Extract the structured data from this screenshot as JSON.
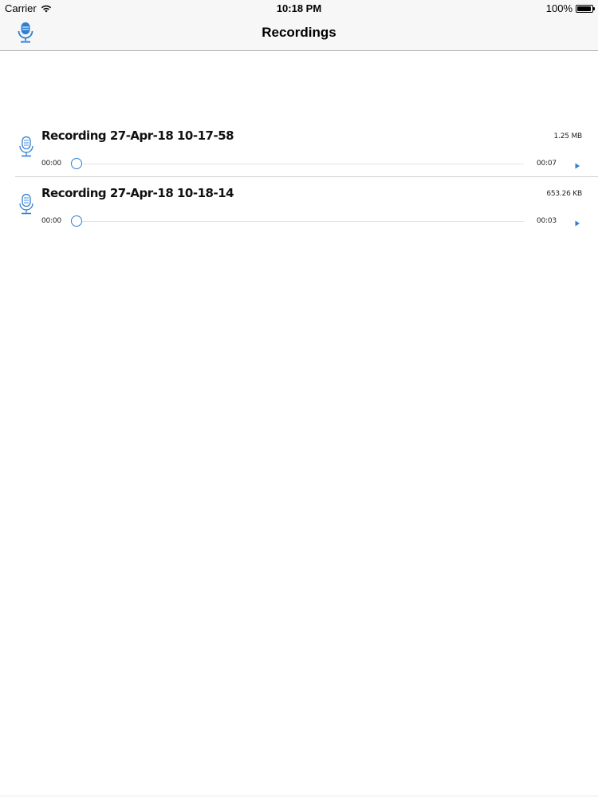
{
  "status_bar": {
    "carrier": "Carrier",
    "time": "10:18 PM",
    "battery": "100%",
    "battery_level": 1.0
  },
  "nav": {
    "title": "Recordings",
    "left_icon": "microphone-icon"
  },
  "recordings": [
    {
      "title": "Recording 27-Apr-18 10-17-58",
      "size": "1.25 MB",
      "current_time": "00:00",
      "duration": "00:07",
      "progress": 0
    },
    {
      "title": "Recording 27-Apr-18 10-18-14",
      "size": "653.26 KB",
      "current_time": "00:00",
      "duration": "00:03",
      "progress": 0
    }
  ],
  "colors": {
    "accent": "#2f7fd1",
    "bar_background": "#f7f7f8"
  }
}
